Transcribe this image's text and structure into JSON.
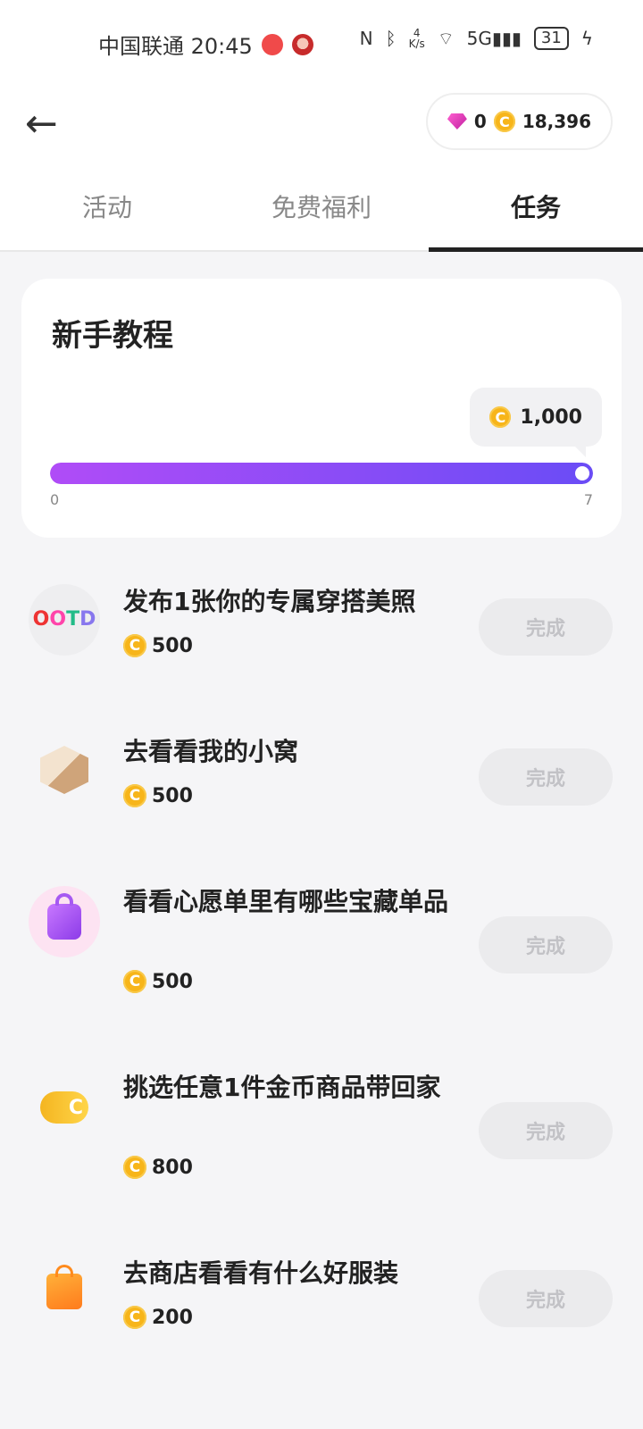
{
  "status_bar": {
    "carrier_time": "中国联通 20:45",
    "net_speed_top": "4",
    "net_speed_unit": "K/s",
    "network": "5G",
    "battery": "31"
  },
  "header": {
    "gems": "0",
    "coins": "18,396"
  },
  "tabs": [
    "活动",
    "免费福利",
    "任务"
  ],
  "active_tab": 2,
  "tutorial": {
    "title": "新手教程",
    "reward": "1,000",
    "progress_min": "0",
    "progress_max": "7",
    "progress_fraction": 1.0
  },
  "tasks": [
    {
      "title": "发布1张你的专属穿搭美照",
      "reward": "500",
      "button": "完成",
      "icon": "ootd-icon"
    },
    {
      "title": "去看看我的小窝",
      "reward": "500",
      "button": "完成",
      "icon": "room-icon"
    },
    {
      "title": "看看心愿单里有哪些宝藏单品",
      "reward": "500",
      "button": "完成",
      "icon": "wishlist-bag-icon"
    },
    {
      "title": "挑选任意1件金币商品带回家",
      "reward": "800",
      "button": "完成",
      "icon": "coins-icon"
    },
    {
      "title": "去商店看看有什么好服装",
      "reward": "200",
      "button": "完成",
      "icon": "shopping-bag-icon"
    }
  ],
  "colors": {
    "accent_start": "#b04cf7",
    "accent_end": "#6a4cf6",
    "coin": "#f7b51a",
    "button_disabled_bg": "#ebebed",
    "button_disabled_text": "#c2c2c6"
  }
}
